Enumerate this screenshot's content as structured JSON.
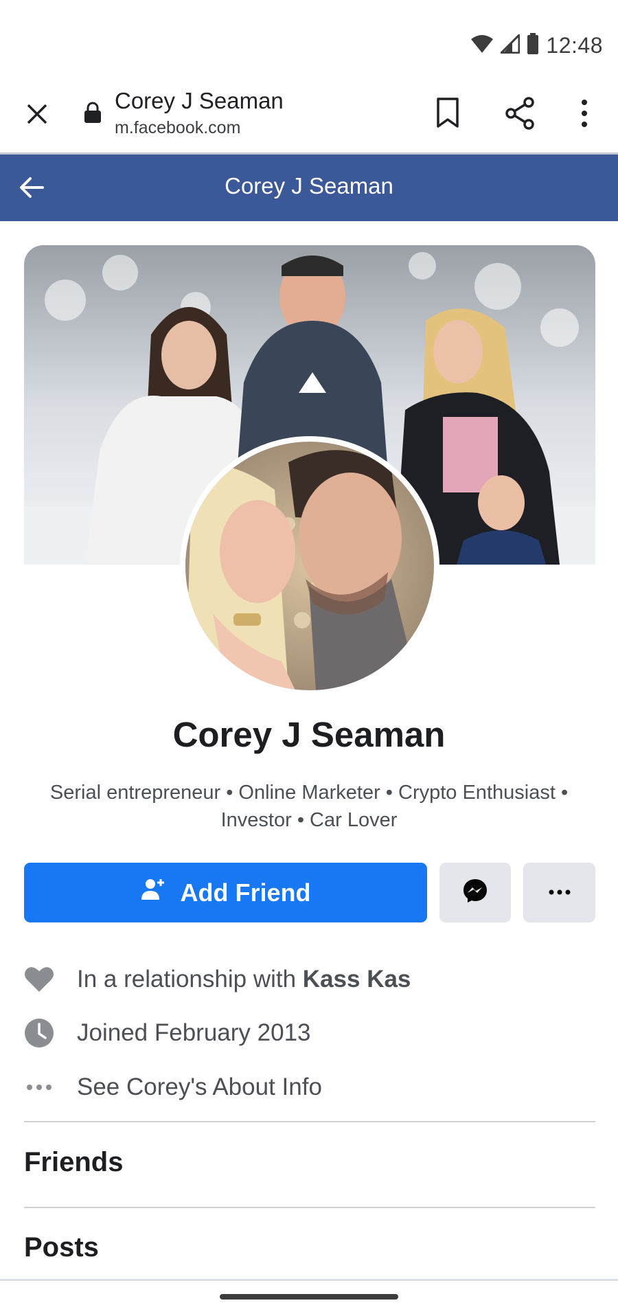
{
  "status_bar": {
    "time": "12:48"
  },
  "browser": {
    "page_title": "Corey J Seaman",
    "host": "m.facebook.com"
  },
  "fb_header": {
    "title": "Corey J Seaman"
  },
  "profile": {
    "name": "Corey J Seaman",
    "bio_line1": "Serial entrepreneur • Online Marketer • Crypto Enthusiast •",
    "bio_line2": "Investor • Car Lover"
  },
  "actions": {
    "add_friend_label": "Add Friend"
  },
  "info": {
    "relationship_prefix": "In a relationship with ",
    "relationship_name": "Kass Kas",
    "joined": "Joined February 2013",
    "about": "See Corey's About Info"
  },
  "sections": {
    "friends": "Friends",
    "posts": "Posts"
  },
  "colors": {
    "fb_header": "#3b5998",
    "primary_button": "#1877f2",
    "secondary_button": "#e4e6eb"
  }
}
